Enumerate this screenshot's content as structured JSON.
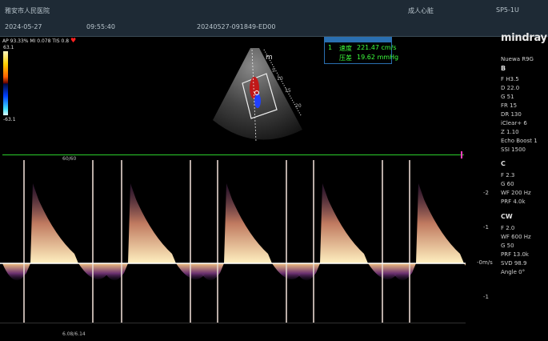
{
  "header": {
    "hospital": "雅安市人民医院",
    "exam": "成人心脏",
    "probe": "SP5-1U",
    "date": "2024-05-27",
    "time": "09:55:40",
    "patient_id": "20240527-091849-ED00"
  },
  "image_params": {
    "line": "AP 93.33%  MI 0.078 TIS 0.8",
    "color_scale_max": "63.1",
    "color_scale_min": "-63.1"
  },
  "measurement": {
    "index": "1",
    "items": [
      {
        "label": "速度",
        "value": "221.47 cm/s"
      },
      {
        "label": "压差",
        "value": "19.62 mmHg"
      }
    ]
  },
  "bmode_labels": {
    "marker": "m",
    "depth": [
      "5",
      "10",
      "15",
      "20"
    ]
  },
  "right_panel": {
    "brand": "mindray",
    "model": "Nuewa R9G",
    "b": {
      "heading": "B",
      "items": [
        "F H3.5",
        "D 22.0",
        "G 51",
        "FR 15",
        "DR 130",
        "iClear+ 6",
        "Z 1.10",
        "Echo Boost 1",
        "SSI 1500"
      ]
    },
    "c": {
      "heading": "C",
      "items": [
        "F 2.3",
        "G 60",
        "WF 200 Hz",
        "PRF 4.0k"
      ]
    },
    "cw": {
      "heading": "CW",
      "items": [
        "F 2.0",
        "WF 600 Hz",
        "G 50",
        "PRF 13.0k",
        "SVD 98.9",
        "Angle     0°"
      ]
    }
  },
  "spectrum": {
    "top_label": "60/60",
    "bottom_label": "6.08/6.14",
    "scale": [
      "-2",
      "-1",
      "-0m/s",
      "-1"
    ],
    "colors": {
      "trace": "#f0c060",
      "baseline": "#ffffff",
      "ecg": "#2bcf2b"
    }
  }
}
